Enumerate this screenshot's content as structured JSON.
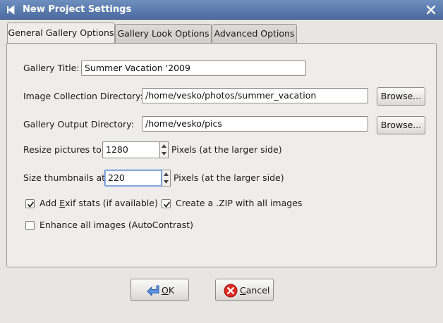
{
  "window": {
    "title": "New Project Settings"
  },
  "tabs": [
    {
      "label": "General Gallery Options",
      "active": true
    },
    {
      "label": "Gallery Look Options",
      "active": false
    },
    {
      "label": "Advanced Options",
      "active": false
    }
  ],
  "form": {
    "gallery_title": {
      "label": "Gallery Title:",
      "value": "Summer Vacation '2009"
    },
    "image_dir": {
      "label": "Image Collection Directory:",
      "value": "/home/vesko/photos/summer_vacation",
      "browse_label": "Browse..."
    },
    "output_dir": {
      "label": "Gallery Output Directory:",
      "value": "/home/vesko/pics",
      "browse_label": "Browse..."
    },
    "resize": {
      "label": "Resize pictures to:",
      "value": "1280",
      "suffix": "Pixels (at the larger side)"
    },
    "thumbs": {
      "label": "Size thumbnails at:",
      "value": "220",
      "suffix": "Pixels (at the larger side)"
    },
    "exif": {
      "label_pre": "Add ",
      "label_mnemonic": "E",
      "label_post": "xif stats (if available)",
      "checked": true
    },
    "zip": {
      "label": "Create a .ZIP with all images",
      "checked": true
    },
    "enhance": {
      "label": "Enhance all images (AutoContrast)",
      "checked": false
    }
  },
  "buttons": {
    "ok": {
      "mnemonic": "O",
      "rest": "K"
    },
    "cancel": {
      "mnemonic": "C",
      "rest": "ancel"
    }
  },
  "colors": {
    "titlebar": "#5a79ad",
    "cancel_icon": "#d8231f",
    "ok_icon": "#3f6fc2"
  }
}
